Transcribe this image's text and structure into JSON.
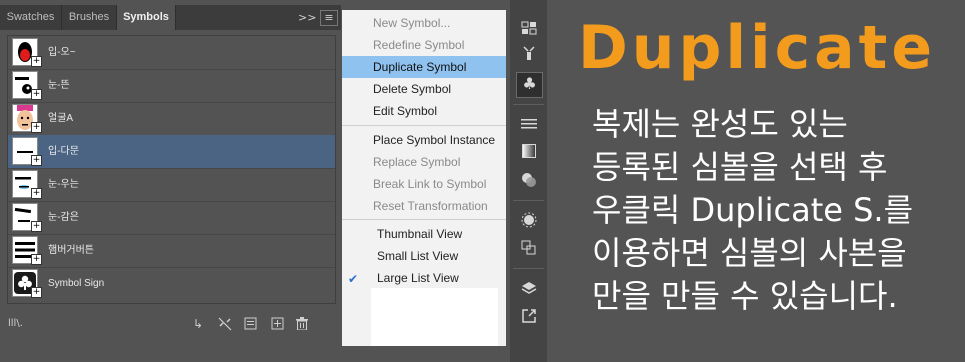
{
  "panel": {
    "tabs": [
      {
        "label": "Swatches"
      },
      {
        "label": "Brushes"
      },
      {
        "label": "Symbols"
      }
    ],
    "collapse_glyph": ">>",
    "menu_glyph": "≡",
    "symbols": [
      {
        "label": "입-오~"
      },
      {
        "label": "눈-뜬"
      },
      {
        "label": "얼굴A"
      },
      {
        "label": "입-다문"
      },
      {
        "label": "눈-우는"
      },
      {
        "label": "눈-감은"
      },
      {
        "label": "햄버거버튼"
      },
      {
        "label": "Symbol Sign"
      }
    ],
    "selected_index": 3,
    "library_glyph": "lll\\."
  },
  "menu": {
    "items": [
      {
        "label": "New Symbol..."
      },
      {
        "label": "Redefine Symbol"
      },
      {
        "label": "Duplicate Symbol"
      },
      {
        "label": "Delete Symbol"
      },
      {
        "label": "Edit Symbol"
      },
      {
        "label": "Place Symbol Instance"
      },
      {
        "label": "Replace Symbol"
      },
      {
        "label": "Break Link to Symbol"
      },
      {
        "label": "Reset Transformation"
      },
      {
        "label": "Thumbnail View"
      },
      {
        "label": "Small List View"
      },
      {
        "label": "Large List View"
      }
    ],
    "highlighted": "Duplicate Symbol",
    "checked": "Large List View",
    "check_glyph": "✔"
  },
  "heading": "Duplicate",
  "description": [
    "복제는 완성도 있는",
    "등록된 심볼을 선택 후",
    "우클릭 Duplicate S.를",
    "이용하면 심볼의 사본을",
    "만을 만들 수 있습니다."
  ],
  "colors": {
    "accent_orange": "#f39b1c",
    "highlight_blue": "#8fc2ef",
    "selected_row": "#4b6483"
  }
}
